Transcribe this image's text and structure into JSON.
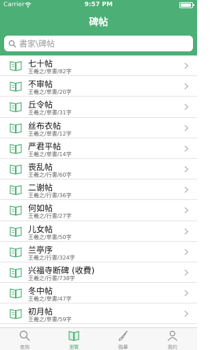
{
  "status": {
    "carrier": "Carrier",
    "time": "9:57 PM"
  },
  "header": {
    "title": "碑帖"
  },
  "search": {
    "placeholder": "書家\\碑帖"
  },
  "list": [
    {
      "name": "七十帖",
      "sub": "王羲之/草書/82字"
    },
    {
      "name": "不审帖",
      "sub": "王羲之/草書/20字"
    },
    {
      "name": "丘令帖",
      "sub": "王羲之/草書/31字"
    },
    {
      "name": "丝布衣帖",
      "sub": "王羲之/草書/12字"
    },
    {
      "name": "严君平帖",
      "sub": "王羲之/草書/14字"
    },
    {
      "name": "丧乱帖",
      "sub": "王羲之/行書/60字"
    },
    {
      "name": "二谢帖",
      "sub": "王羲之/行書/36字"
    },
    {
      "name": "何如帖",
      "sub": "王羲之/行書/27字"
    },
    {
      "name": "儿女帖",
      "sub": "王羲之/草書/50字"
    },
    {
      "name": "兰亭序",
      "sub": "王羲之/行書/324字"
    },
    {
      "name": "兴福寺断碑 (收費)",
      "sub": "王羲之/行書/738字"
    },
    {
      "name": "冬中帖",
      "sub": "王羲之/草書/47字"
    },
    {
      "name": "初月帖",
      "sub": "王羲之/草書/59字"
    }
  ],
  "tabs": [
    {
      "label": "查詢",
      "icon": "search-icon"
    },
    {
      "label": "瀏覽",
      "icon": "book-icon",
      "active": true
    },
    {
      "label": "臨摹",
      "icon": "brush-icon"
    },
    {
      "label": "我的",
      "icon": "person-icon"
    }
  ],
  "colors": {
    "accent": "#4caf76",
    "separator": "#e2e2e2",
    "tab_inactive": "#8e8e8e"
  }
}
